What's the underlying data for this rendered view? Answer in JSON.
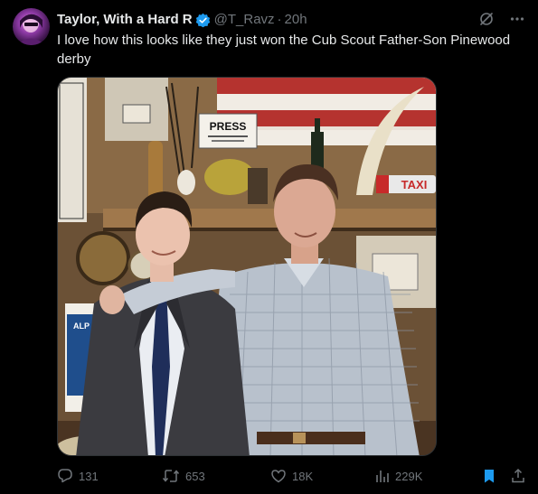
{
  "tweet": {
    "display_name": "Taylor, With a Hard R",
    "handle": "@T_Ravz",
    "separator": "·",
    "time": "20h",
    "text": "I love how this looks like they just won the Cub Scout Father-Son Pinewood derby",
    "media": {
      "sign_press": "PRESS",
      "sign_taxi": "TAXI",
      "sign_alp": "ALP"
    }
  },
  "actions": {
    "replies": "131",
    "retweets": "653",
    "likes": "18K",
    "views": "229K"
  },
  "colors": {
    "background": "#000000",
    "text": "#e7e9ea",
    "muted": "#71767b",
    "verified": "#1d9bf0",
    "bookmark_active": "#1d9bf0"
  },
  "icons": [
    "verified-badge-icon",
    "grok-icon",
    "more-icon",
    "reply-icon",
    "retweet-icon",
    "like-icon",
    "views-icon",
    "bookmark-icon",
    "share-icon"
  ]
}
